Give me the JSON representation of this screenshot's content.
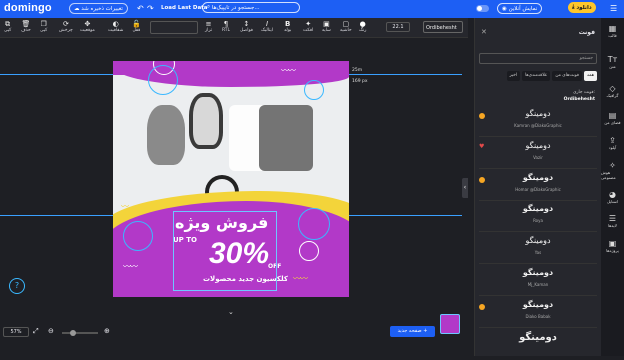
{
  "app": {
    "logo": "domingo"
  },
  "topbar": {
    "saved_status": "تغییرات ذخیره شد",
    "load_last": "Load Last Data",
    "search_placeholder": "جستجو در تایپیک‌ها...",
    "preview": "نمایش آنلاین",
    "download": "دانلود"
  },
  "toolbar": {
    "items_left": [
      "کپی",
      "حذف",
      "کپی",
      "چرخش",
      "موقعیت",
      "شفافیت",
      "قفل"
    ],
    "items_right": [
      "تراز",
      "RTL",
      "فواصل",
      "ایتالیک",
      "بولد",
      "افکت",
      "سایه",
      "حاشیه",
      "رنگ"
    ],
    "size": "22.1",
    "font": "Ordibehesht"
  },
  "canvas": {
    "headline": "فروش ویژه",
    "upto": "UP TO",
    "big": "30%",
    "off": "OFF",
    "sub": "کلکسیون جدید محصولات",
    "coord_a": "25m",
    "coord_b": "169 px"
  },
  "bottombar": {
    "zoom": "57%",
    "new_page": "صفحه جدید +"
  },
  "fontpanel": {
    "title": "فونت",
    "search_placeholder": "جستجو",
    "tabs": [
      "همه",
      "فونت‌های من",
      "علاقه‌مندی‌ها",
      "اخیر"
    ],
    "current_label": "فونت جاری:",
    "current_value": "Ordibehesht",
    "fonts": [
      {
        "name": "دومینگو",
        "author": "Kamran @DiakoGraphic",
        "mark": "badge"
      },
      {
        "name": "دومینگو",
        "author": "Vazir",
        "mark": "heart"
      },
      {
        "name": "دومینگو",
        "author": "Homar @DiakoGraphic",
        "mark": "badge"
      },
      {
        "name": "دومینگو",
        "author": "Roya",
        "mark": ""
      },
      {
        "name": "دومینگو",
        "author": "Yas",
        "mark": ""
      },
      {
        "name": "دومینگو",
        "author": "Mj_Kaman",
        "mark": ""
      },
      {
        "name": "دومینگو",
        "author": "Diako Babak",
        "mark": "badge"
      },
      {
        "name": "دومینگو",
        "author": "",
        "mark": ""
      }
    ]
  },
  "sidebar": {
    "items": [
      "قالب",
      "متن",
      "گرافیک",
      "فضای من",
      "آپلود",
      "هوش مصنوعی",
      "استایل",
      "لایه‌ها",
      "پروژه‌ها"
    ]
  }
}
